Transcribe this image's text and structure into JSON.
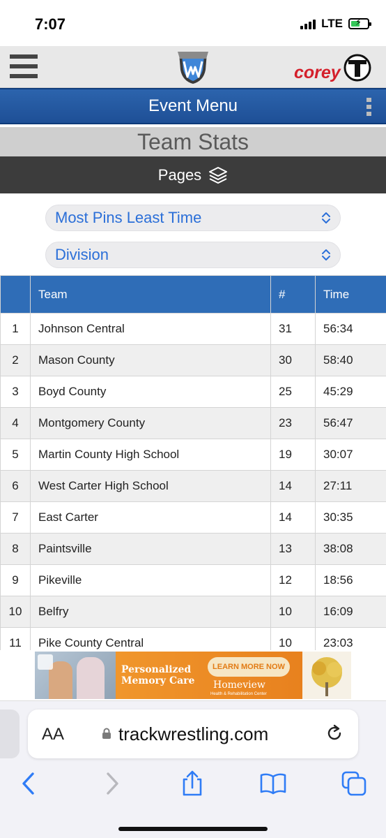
{
  "status": {
    "time": "7:07",
    "network": "LTE"
  },
  "header": {
    "brand_right": "corey"
  },
  "event_menu": {
    "title": "Event Menu"
  },
  "page": {
    "title": "Team Stats"
  },
  "pages_bar": {
    "label": "Pages"
  },
  "filters": {
    "sort": {
      "value": "Most Pins Least Time"
    },
    "group": {
      "value": "Division"
    }
  },
  "table": {
    "columns": [
      "",
      "Team",
      "#",
      "Time"
    ],
    "rows": [
      {
        "rank": "1",
        "team": "Johnson Central",
        "count": "31",
        "time": "56:34"
      },
      {
        "rank": "2",
        "team": "Mason County",
        "count": "30",
        "time": "58:40"
      },
      {
        "rank": "3",
        "team": "Boyd County",
        "count": "25",
        "time": "45:29"
      },
      {
        "rank": "4",
        "team": "Montgomery County",
        "count": "23",
        "time": "56:47"
      },
      {
        "rank": "5",
        "team": "Martin County High School",
        "count": "19",
        "time": "30:07"
      },
      {
        "rank": "6",
        "team": "West Carter High School",
        "count": "14",
        "time": "27:11"
      },
      {
        "rank": "7",
        "team": "East Carter",
        "count": "14",
        "time": "30:35"
      },
      {
        "rank": "8",
        "team": "Paintsville",
        "count": "13",
        "time": "38:08"
      },
      {
        "rank": "9",
        "team": "Pikeville",
        "count": "12",
        "time": "18:56"
      },
      {
        "rank": "10",
        "team": "Belfry",
        "count": "10",
        "time": "16:09"
      },
      {
        "rank": "11",
        "team": "Pike County Central",
        "count": "10",
        "time": "23:03"
      }
    ]
  },
  "ad": {
    "headline_line1": "Personalized",
    "headline_line2": "Memory Care",
    "cta": "LEARN MORE NOW",
    "brand": "Homeview",
    "brand_sub": "Health & Rehabilitation Center"
  },
  "browser": {
    "text_size_label": "AA",
    "domain": "trackwrestling.com"
  },
  "colors": {
    "accent_blue": "#2f6db7",
    "select_text": "#2b6fd8",
    "brand_red": "#d41f2b",
    "safari_blue": "#2f7cf6"
  }
}
